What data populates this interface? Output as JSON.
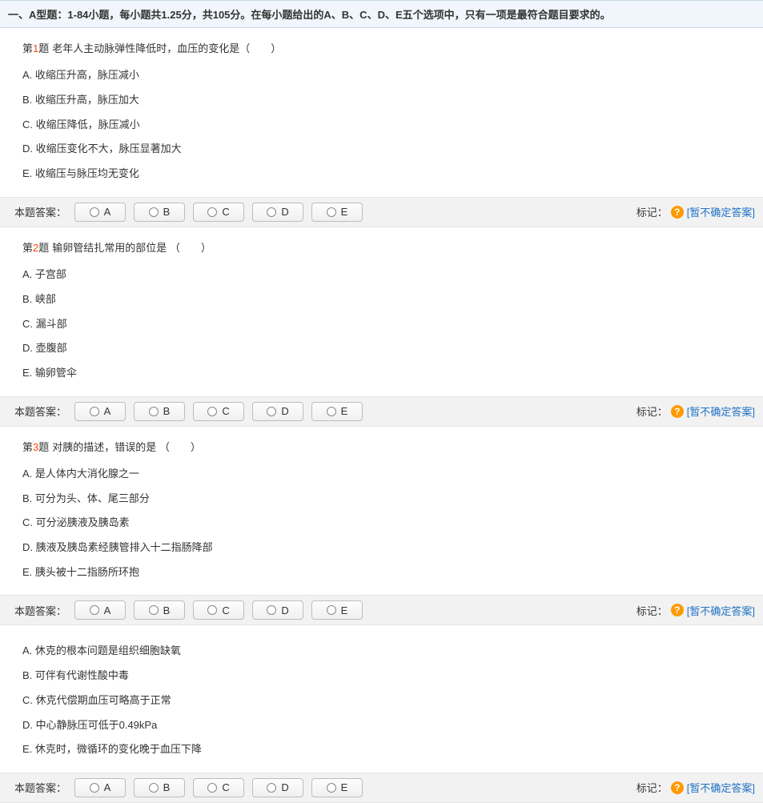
{
  "section_header": "一、A型题：1-84小题，每小题共1.25分，共105分。在每小题给出的A、B、C、D、E五个选项中，只有一项是最符合题目要求的。",
  "answer_bar": {
    "label": "本题答案：",
    "options": [
      "A",
      "B",
      "C",
      "D",
      "E"
    ],
    "mark_label": "标记：",
    "help_glyph": "?",
    "uncertain_text": "[暂不确定答案]"
  },
  "questions": [
    {
      "prefix": "第",
      "num": "1",
      "suffix": "题",
      "stem": "老年人主动脉弹性降低时，血压的变化是（　　）",
      "options": [
        "A. 收缩压升高，脉压减小",
        "B. 收缩压升高，脉压加大",
        "C. 收缩压降低，脉压减小",
        "D. 收缩压变化不大，脉压显著加大",
        "E. 收缩压与脉压均无变化"
      ]
    },
    {
      "prefix": "第",
      "num": "2",
      "suffix": "题",
      "stem": "输卵管结扎常用的部位是 （　　）",
      "options": [
        "A. 子宫部",
        "B. 峡部",
        "C. 漏斗部",
        "D. 壶腹部",
        "E. 输卵管伞"
      ]
    },
    {
      "prefix": "第",
      "num": "3",
      "suffix": "题",
      "stem": "对胰的描述，错误的是 （　　）",
      "options": [
        "A. 是人体内大消化腺之一",
        "B. 可分为头、体、尾三部分",
        "C. 可分泌胰液及胰岛素",
        "D. 胰液及胰岛素经胰管排入十二指肠降部",
        "E. 胰头被十二指肠所环抱"
      ]
    },
    {
      "prefix": "",
      "num": "",
      "suffix": "",
      "stem": "",
      "options": [
        "A. 休克的根本问题是组织细胞缺氧",
        "B. 可伴有代谢性酸中毒",
        "C. 休克代偿期血压可略高于正常",
        "D. 中心静脉压可低于0.49kPa",
        "E. 休克时，微循环的变化晚于血压下降"
      ]
    }
  ]
}
